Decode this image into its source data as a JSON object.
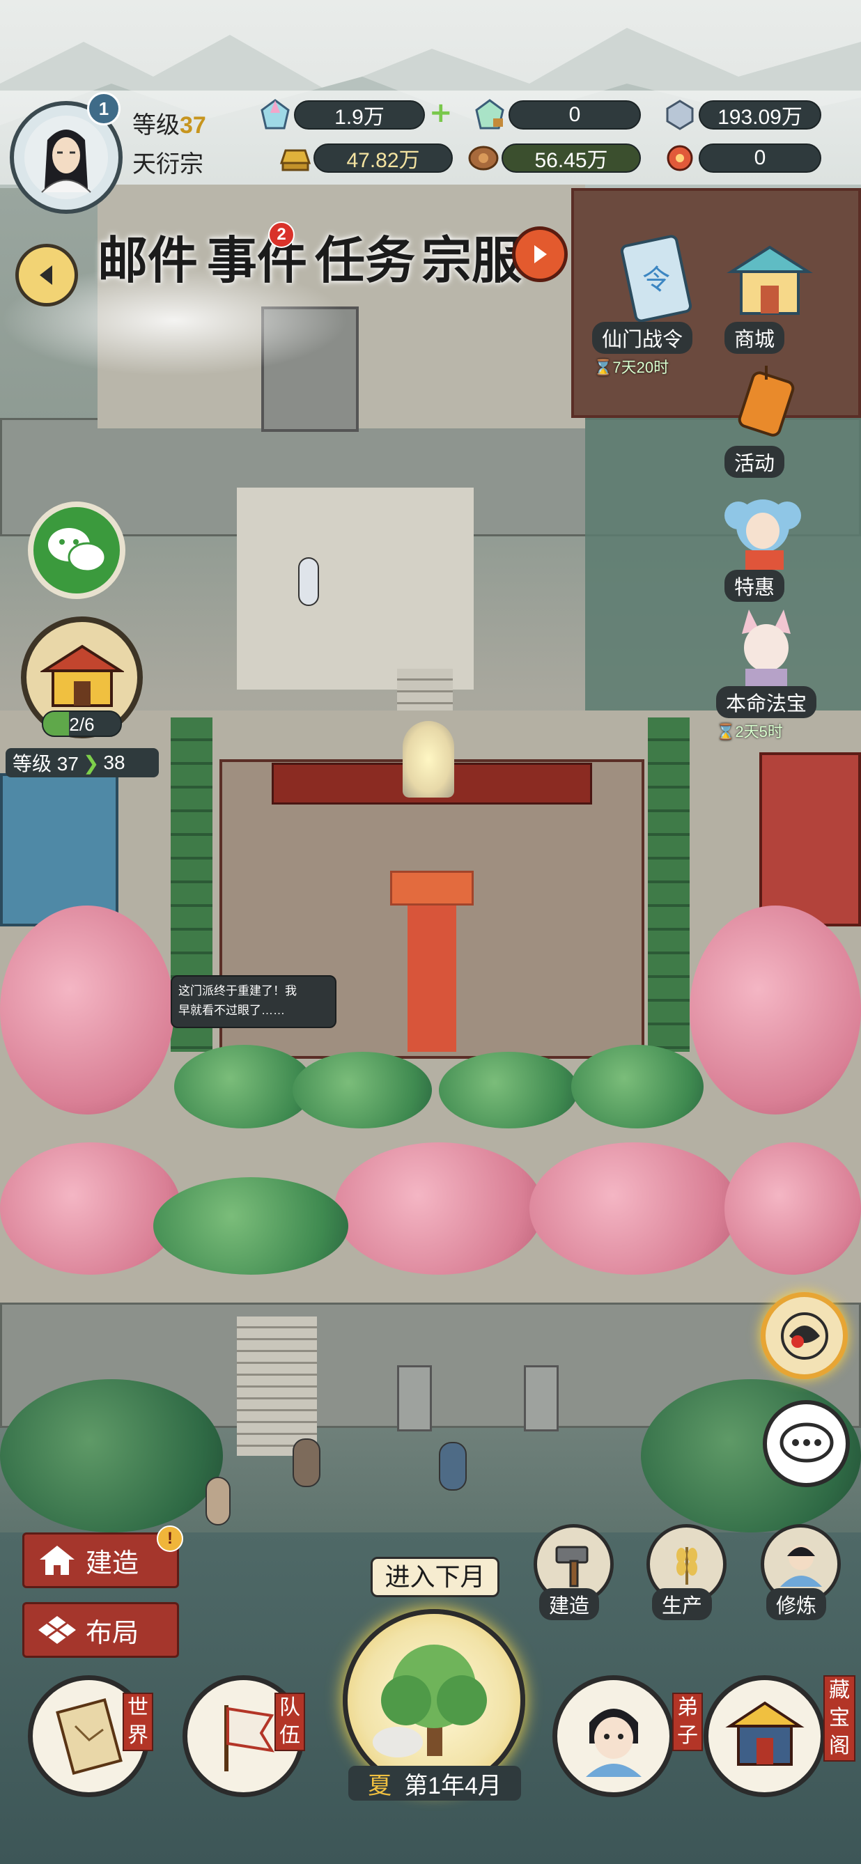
{
  "player": {
    "level_label": "等级",
    "level": "37",
    "sect": "天衍宗",
    "avatar_rank": "1"
  },
  "resources": [
    {
      "name": "spirit-stone",
      "value": "1.9万",
      "has_plus": true
    },
    {
      "name": "locked-spirit-stone",
      "value": "0"
    },
    {
      "name": "crystal",
      "value": "193.09万"
    },
    {
      "name": "gold",
      "value": "47.82万"
    },
    {
      "name": "wood",
      "value": "56.45万"
    },
    {
      "name": "pill",
      "value": "0"
    }
  ],
  "top_menu": {
    "mail": "邮件",
    "events": "事件",
    "events_badge": "2",
    "tasks": "任务",
    "clothing": "宗服"
  },
  "right_menu": {
    "battle_pass": "仙门战令",
    "battle_pass_timer": "7天20时",
    "shop": "商城",
    "activity": "活动",
    "special": "特惠",
    "artifact": "本命法宝",
    "artifact_timer": "2天5时"
  },
  "left_panel": {
    "building_progress": "2/6",
    "level_from_label": "等级 37",
    "level_to": "38"
  },
  "dialog": {
    "text_line1": "这门派终于重建了！我",
    "text_line2": "早就看不过眼了……"
  },
  "bottom_left": {
    "build": "建造",
    "layout": "布局",
    "build_badge": "!"
  },
  "bottom_actions": {
    "build": "建造",
    "produce": "生产",
    "cultivate": "修炼"
  },
  "center": {
    "next_month": "进入下月",
    "season": "夏",
    "date": "第1年4月"
  },
  "bottom_nav": {
    "world_1": "世",
    "world_2": "界",
    "team_1": "队",
    "team_2": "伍",
    "disciple_1": "弟",
    "disciple_2": "子",
    "treasure_1": "藏",
    "treasure_2": "宝",
    "treasure_3": "阁"
  },
  "colors": {
    "accent_gold": "#f0c040",
    "panel_dark": "#2f3a3d",
    "button_red": "#a5362c",
    "timer_green": "#d9ffcf"
  }
}
